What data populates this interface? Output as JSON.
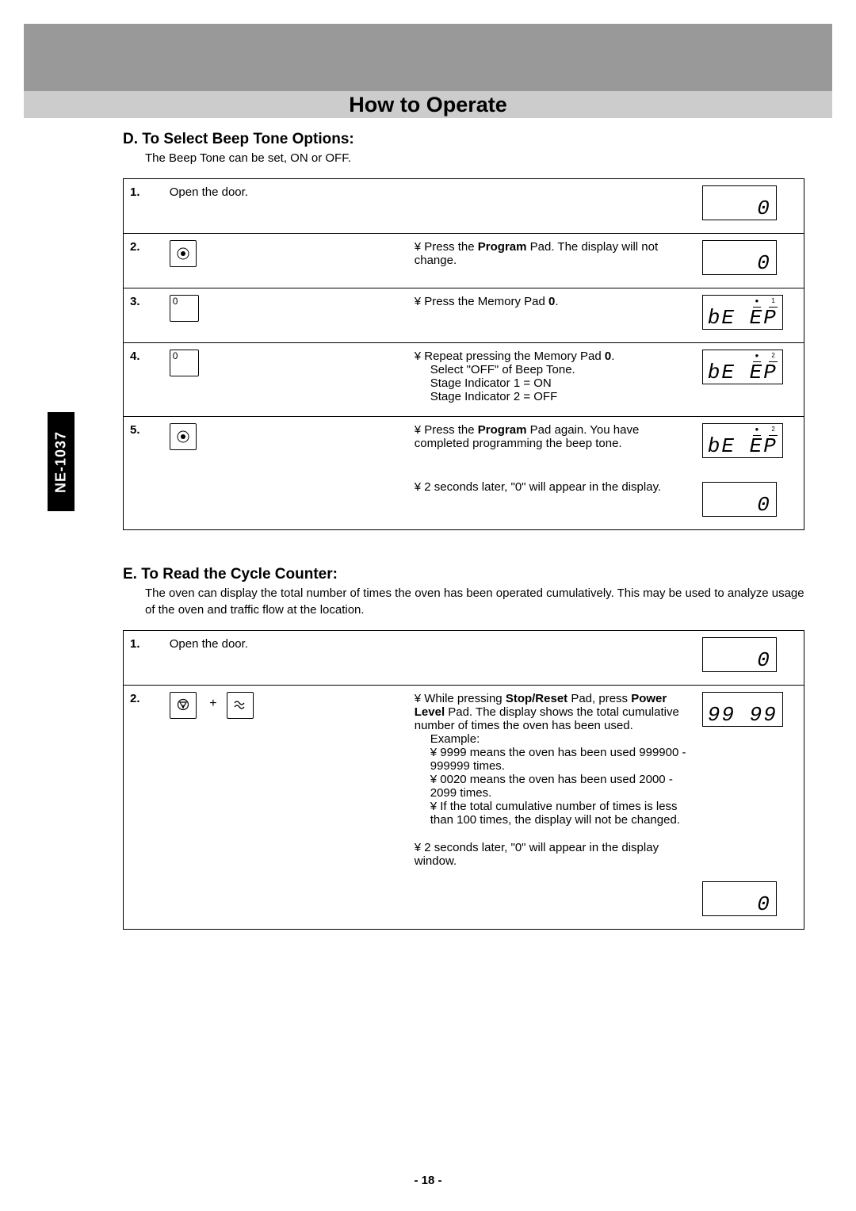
{
  "page_title": "How to Operate",
  "model_tab": "NE-1037",
  "page_number": "- 18 -",
  "section_d": {
    "title": "D. To Select Beep Tone Options:",
    "intro": "The Beep Tone can be set, ON or OFF.",
    "steps": [
      {
        "num": "1.",
        "control": "Open the door.",
        "desc": "",
        "display": {
          "text": "0",
          "icons": []
        }
      },
      {
        "num": "2.",
        "control_icon": "program",
        "desc_prefix": "¥ Press the ",
        "desc_bold": "Program",
        "desc_suffix": " Pad. The display will not change.",
        "display": {
          "text": "0",
          "icons": []
        }
      },
      {
        "num": "3.",
        "control_icon": "zero",
        "desc_prefix": "¥ Press the Memory Pad ",
        "desc_bold": "0",
        "desc_suffix": ".",
        "display": {
          "text": "bE EP",
          "icons": [
            "●",
            "1"
          ]
        }
      },
      {
        "num": "4.",
        "control_icon": "zero",
        "desc_prefix": "¥ Repeat pressing the Memory Pad ",
        "desc_bold": "0",
        "desc_suffix": ".",
        "desc_extra1": "Select \"OFF\" of Beep Tone.",
        "desc_extra2": "Stage Indicator 1 = ON",
        "desc_extra3": "Stage Indicator 2 = OFF",
        "display": {
          "text": "bE EP",
          "icons": [
            "●",
            "2"
          ]
        }
      },
      {
        "num": "5.",
        "control_icon": "program",
        "desc_prefix": "¥ Press the ",
        "desc_bold": "Program",
        "desc_suffix": " Pad again. You have completed programming the beep tone.",
        "display": {
          "text": "bE EP",
          "icons": [
            "●",
            "2"
          ]
        },
        "later_text": "¥ 2 seconds later, \"0\" will appear in the display.",
        "later_display": {
          "text": "0",
          "icons": []
        }
      }
    ]
  },
  "section_e": {
    "title": "E. To Read the Cycle Counter:",
    "intro": "The oven can display the total number of times the oven has been operated cumulatively. This may be used to analyze usage of the oven and traffic flow at the location.",
    "steps": [
      {
        "num": "1.",
        "control": "Open the door.",
        "desc": "",
        "display": {
          "text": "0",
          "icons": []
        }
      },
      {
        "num": "2.",
        "control_icon": "stop-reset-plus-power",
        "desc_line1_pre": "¥ While pressing ",
        "desc_line1_bold": "Stop/Reset",
        "desc_line1_mid": " Pad, press ",
        "desc_line1_bold2": "Power Level",
        "desc_line1_post": " Pad. The display shows the total cumulative number of times the oven has been used.",
        "desc_example_label": "Example:",
        "desc_example1": "¥ 9999 means the oven has been used 999900 - 999999 times.",
        "desc_example2": "¥ 0020 means the oven has been used 2000 - 2099 times.",
        "desc_example3": "¥ If the total cumulative number of times is less than 100 times, the display will not be changed.",
        "display": {
          "text": "99 99",
          "icons": []
        },
        "later_text": "¥ 2 seconds later, \"0\" will appear in the display window.",
        "later_display": {
          "text": "0",
          "icons": []
        }
      }
    ]
  }
}
